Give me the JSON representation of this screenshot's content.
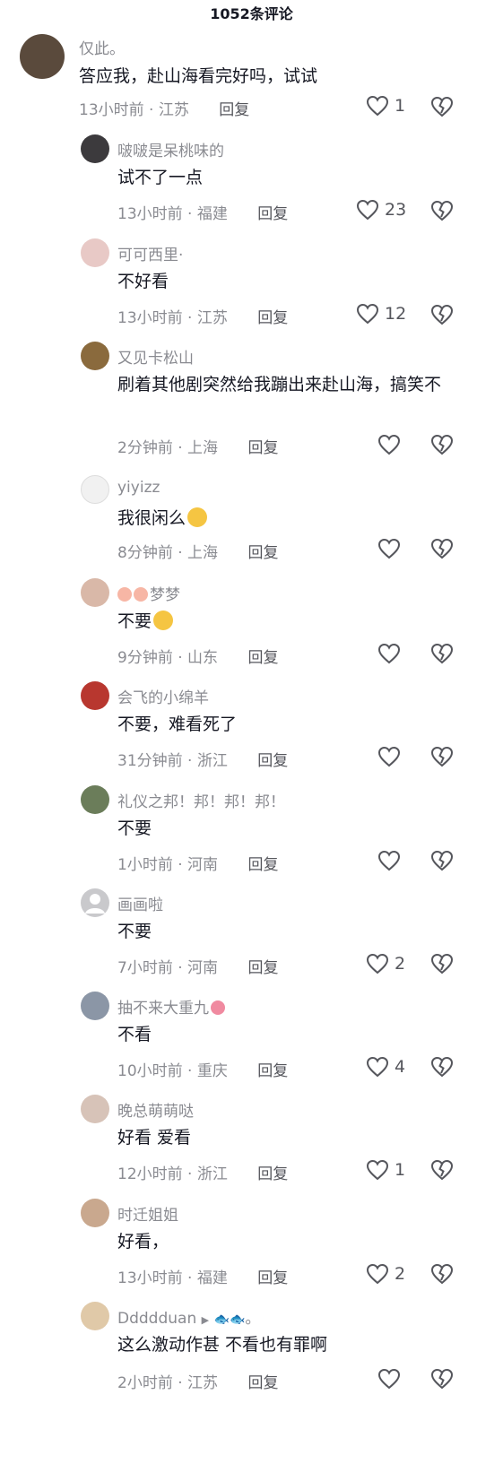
{
  "header": {
    "title": "1052条评论"
  },
  "comments": [
    {
      "name": "仅此。",
      "text": "答应我，赴山海看完好吗，试试",
      "time": "13小时前",
      "region": "江苏",
      "reply": "回复",
      "likes": "1",
      "avatar_color": "#5a4a3c"
    },
    {
      "name": "啵啵是呆桃味的",
      "text": "试不了一点",
      "time": "13小时前",
      "region": "福建",
      "reply": "回复",
      "likes": "23",
      "avatar_color": "#3c3a3d"
    },
    {
      "name": "可可西里·",
      "text": "不好看",
      "time": "13小时前",
      "region": "江苏",
      "reply": "回复",
      "likes": "12",
      "avatar_color": "#e8c9c6"
    },
    {
      "name": "又见卡松山",
      "text": "刷着其他剧突然给我蹦出来赴山海，搞笑不",
      "time": "2分钟前",
      "region": "上海",
      "reply": "回复",
      "likes": "",
      "avatar_color": "#8a6a3d"
    },
    {
      "name": "yiyizz",
      "text": "我很闲么",
      "time": "8分钟前",
      "region": "上海",
      "reply": "回复",
      "likes": "",
      "avatar_color": "#f1f1f1"
    },
    {
      "name": "梦梦",
      "text": "不要",
      "time": "9分钟前",
      "region": "山东",
      "reply": "回复",
      "likes": "",
      "avatar_color": "#d9b8a8"
    },
    {
      "name": "会飞的小绵羊",
      "text": "不要，难看死了",
      "time": "31分钟前",
      "region": "浙江",
      "reply": "回复",
      "likes": "",
      "avatar_color": "#b8372f"
    },
    {
      "name": "礼仪之邦！邦！邦！邦！",
      "text": "不要",
      "time": "1小时前",
      "region": "河南",
      "reply": "回复",
      "likes": "",
      "avatar_color": "#6b7d5a"
    },
    {
      "name": "画画啦",
      "text": "不要",
      "time": "7小时前",
      "region": "河南",
      "reply": "回复",
      "likes": "2",
      "avatar_color": "#c9c9cc"
    },
    {
      "name": "抽不来大重九",
      "text": "不看",
      "time": "10小时前",
      "region": "重庆",
      "reply": "回复",
      "likes": "4",
      "avatar_color": "#8b96a6"
    },
    {
      "name": "晚总萌萌哒",
      "text": "好看 爱看",
      "time": "12小时前",
      "region": "浙江",
      "reply": "回复",
      "likes": "1",
      "avatar_color": "#d7c3b8"
    },
    {
      "name": "时迁姐姐",
      "text": "好看，",
      "time": "13小时前",
      "region": "福建",
      "reply": "回复",
      "likes": "2",
      "avatar_color": "#c9a88e"
    },
    {
      "name": "Ddddduan",
      "text": "这么激动作甚 不看也有罪啊",
      "time": "2小时前",
      "region": "江苏",
      "reply": "回复",
      "likes": "",
      "avatar_color": "#e0c9a8"
    }
  ],
  "meta_separator": "·",
  "name_suffix_13": "。"
}
